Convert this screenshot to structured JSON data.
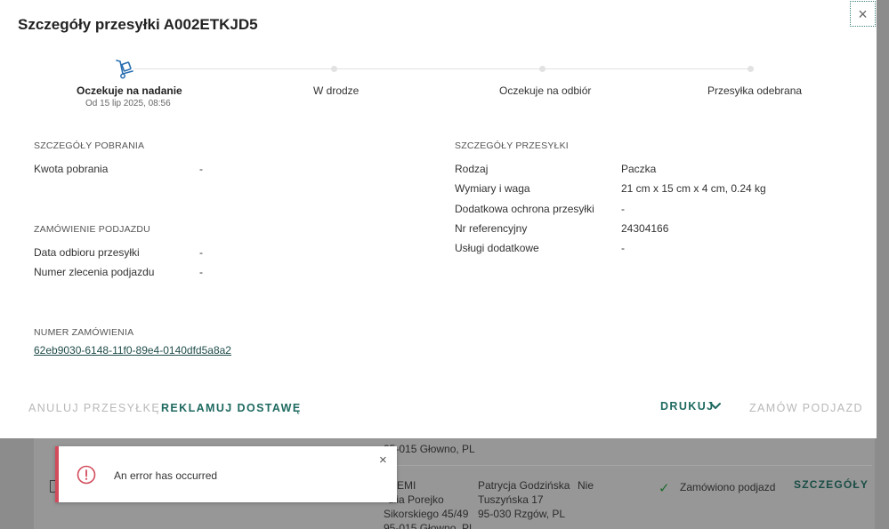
{
  "modal": {
    "title": "Szczegóły przesyłki A002ETKJD5",
    "close_icon": "close-icon"
  },
  "stepper": {
    "steps": [
      {
        "label": "Oczekuje na nadanie",
        "sub": "Od 15 lip 2025, 08:56",
        "active": true,
        "icon": "hand-truck-icon"
      },
      {
        "label": "W drodze"
      },
      {
        "label": "Oczekuje na odbiór"
      },
      {
        "label": "Przesyłka odebrana"
      }
    ]
  },
  "cod": {
    "heading": "SZCZEGÓŁY POBRANIA",
    "rows": [
      {
        "label": "Kwota pobrania",
        "value": "-"
      }
    ]
  },
  "pickup": {
    "heading": "ZAMÓWIENIE PODJAZDU",
    "rows": [
      {
        "label": "Data odbioru przesyłki",
        "value": "-"
      },
      {
        "label": "Numer zlecenia podjazdu",
        "value": "-"
      }
    ]
  },
  "order": {
    "heading": "NUMER ZAMÓWIENIA",
    "link": "62eb9030-6148-11f0-89e4-0140dfd5a8a2"
  },
  "shipment": {
    "heading": "SZCZEGÓŁY PRZESYŁKI",
    "rows": [
      {
        "label": "Rodzaj",
        "value": "Paczka"
      },
      {
        "label": "Wymiary i waga",
        "value": "21 cm x 15 cm x 4 cm, 0.24 kg"
      },
      {
        "label": "Dodatkowa ochrona przesyłki",
        "value": "-"
      },
      {
        "label": "Nr referencyjny",
        "value": "24304166"
      },
      {
        "label": "Usługi dodatkowe",
        "value": "-"
      }
    ]
  },
  "actions": {
    "cancel": "ANULUJ PRZESYŁKĘ",
    "complain": "REKLAMUJ DOSTAWĘ",
    "print": "DRUKUJ",
    "order_pickup": "ZAMÓW PODJAZD"
  },
  "toast": {
    "message": "An error has occurred",
    "accent_color": "#d24b5c"
  },
  "background": {
    "row1_city": "95-015 Głowno, PL",
    "sender_name": "EMI",
    "sender_person": "ulia Porejko",
    "sender_street": "Sikorskiego 45/49",
    "sender_city": "95-015 Głowno, PL",
    "recipient_name": "Patrycja Godzińska",
    "recipient_street": "Tuszyńska 17",
    "recipient_city": "95-030 Rzgów, PL",
    "flag": "Nie",
    "status": "Zamówiono podjazd",
    "details_link": "SZCZEGÓŁY"
  },
  "colors": {
    "primary": "#1e6a60",
    "error": "#d24b5c",
    "disabled": "#b8b8b8"
  }
}
